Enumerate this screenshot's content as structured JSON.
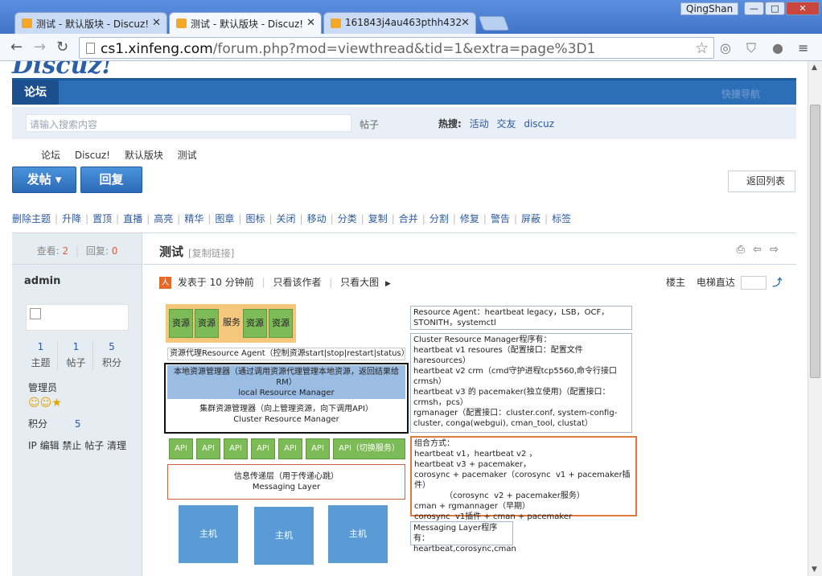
{
  "browser": {
    "tabs": [
      {
        "title": "测试 - 默认版块 - Discuz!",
        "active": false
      },
      {
        "title": "测试 - 默认版块 - Discuz!",
        "active": true
      },
      {
        "title": "161843j4au463pthh432",
        "active": false
      }
    ],
    "user": "QingShan",
    "url_host": "cs1.xinfeng.com",
    "url_rest": "/forum.php?mod=viewthread&tid=1&extra=page%3D1",
    "window_buttons": {
      "minimize": "—",
      "maximize": "□",
      "close": "✕"
    }
  },
  "site": {
    "logo": "Discuz!",
    "nav": {
      "active": "论坛",
      "quick": "快捷导航"
    },
    "search": {
      "placeholder": "请输入搜索内容",
      "type": "帖子",
      "hot_label": "热搜:",
      "hot": [
        "活动",
        "交友",
        "discuz"
      ]
    },
    "breadcrumb": [
      "论坛",
      "Discuz!",
      "默认版块",
      "测试"
    ],
    "buttons": {
      "post": "发帖 ▾",
      "reply": "回复",
      "back": "返回列表"
    },
    "mod_actions": [
      "删除主题",
      "升降",
      "置顶",
      "直播",
      "高亮",
      "精华",
      "图章",
      "图标",
      "关闭",
      "移动",
      "分类",
      "复制",
      "合并",
      "分割",
      "修复",
      "警告",
      "屏蔽",
      "标签"
    ]
  },
  "thread": {
    "views_label": "查看:",
    "views": "2",
    "replies_label": "回复:",
    "replies": "0",
    "author": "admin",
    "stats": [
      {
        "value": "1",
        "label": "主题"
      },
      {
        "value": "1",
        "label": "帖子"
      },
      {
        "value": "5",
        "label": "积分"
      }
    ],
    "group": "管理员",
    "points_label": "积分",
    "points": "5",
    "actions": "IP 编辑 禁止 帖子 清理",
    "title": "测试",
    "copy_link": "[复制链接]",
    "posted_at": "发表于 10 分钟前",
    "only_author": "只看该作者",
    "big_image": "只看大图",
    "floor_label": "楼主",
    "jump_label": "电梯直达"
  },
  "diagram": {
    "top_boxes": [
      "资源",
      "资源",
      "服务",
      "资源",
      "资源"
    ],
    "agent_bar": "资源代理Resource Agent（控制资源start|stop|restart|status）",
    "lrm_cn": "本地资源管理器（通过调用资源代理管理本地资源，返回结果给RM）",
    "lrm_en": "local Resource Manager",
    "crm_cn": "集群资源管理器（向上管理资源，向下调用API）",
    "crm_en": "Cluster Resource Manager",
    "apis": [
      "API",
      "API",
      "API",
      "API",
      "API",
      "API",
      "API（切换服务）"
    ],
    "msg_cn": "信息传递层（用于传递心跳）",
    "msg_en": "Messaging Layer",
    "hosts": [
      "主机",
      "主机",
      "主机"
    ],
    "ra_note": "Resource Agent：heartbeat legacy，LSB，OCF，STONITH，systemctl",
    "crm_note": "Cluster Resource Manager程序有：\nheartbeat v1 resoures（配置接口：配置文件haresources）\nheartbeat v2 crm（cmd守护进程tcp5560,命令行接口crmsh）\nheartbeat v3 的 pacemaker(独立使用)（配置接口：crmsh，pcs）\nrgmanager（配置接口：cluster.conf, system-config-cluster, conga(webgui), cman_tool, clustat）",
    "combo_note": "组合方式：\nheartbeat v1，heartbeat v2 ，\nheartbeat v3 + pacemaker，\ncorosync + pacemaker（corosync  v1 + pacemaker插件）\n            （corosync  v2 + pacemaker服务）\ncman + rgmannager（早期）\ncorosync  v1插件 + cman + pacemaker",
    "msg_note": "Messaging Layer程序有：\nheartbeat,corosync,cman"
  }
}
